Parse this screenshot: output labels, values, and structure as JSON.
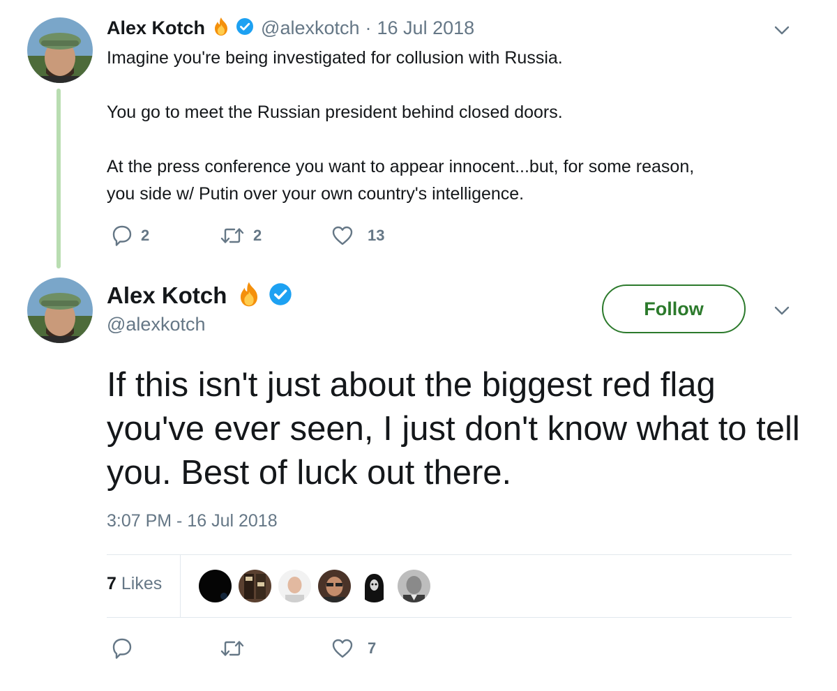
{
  "tweet1": {
    "name": "Alex Kotch",
    "handle": "@alexkotch",
    "separator": "·",
    "date": "16 Jul 2018",
    "lines": [
      "Imagine you're being investigated for collusion with Russia.",
      "You go to meet the Russian president behind closed doors.",
      "At the press conference you want to appear innocent...but, for some reason,",
      "you side w/ Putin over your own country's intelligence."
    ],
    "replies": "2",
    "retweets": "2",
    "likes": "13"
  },
  "tweet2": {
    "name": "Alex Kotch",
    "handle": "@alexkotch",
    "follow_label": "Follow",
    "text": "If this isn't just about the biggest red flag you've ever seen, I just don't know what to tell you. Best of luck out there.",
    "timestamp": "3:07 PM - 16 Jul 2018",
    "likes_count": "7",
    "likes_label": "Likes",
    "action_likes": "7"
  },
  "icons": {
    "reply": "reply-icon",
    "retweet": "retweet-icon",
    "like": "heart-icon",
    "verified": "verified-badge-icon",
    "fire": "fire-emoji-icon",
    "caret": "chevron-down-icon"
  },
  "colors": {
    "follow_green": "#2c7a2c",
    "thread_line": "#b9ddb1",
    "verified_blue": "#1da1f2",
    "muted_text": "#657786"
  }
}
